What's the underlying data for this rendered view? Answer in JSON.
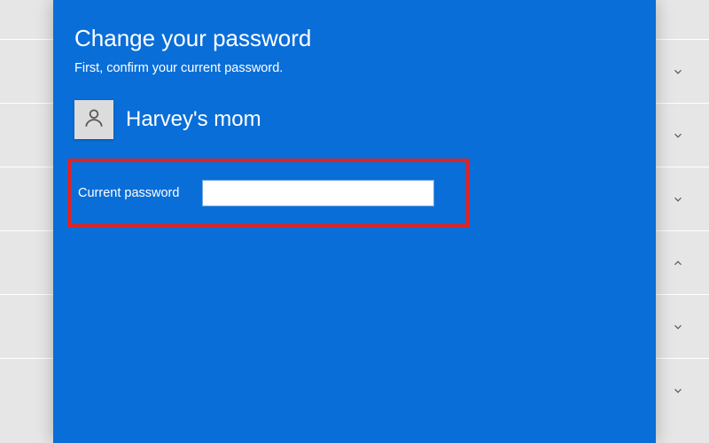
{
  "dialog": {
    "title": "Change your password",
    "subtitle": "First, confirm your current password."
  },
  "user": {
    "display_name": "Harvey's  mom"
  },
  "field": {
    "label": "Current password",
    "value": ""
  },
  "bg_rows": [
    {
      "dir": "down"
    },
    {
      "dir": "down"
    },
    {
      "dir": "down"
    },
    {
      "dir": "up"
    },
    {
      "dir": "down"
    },
    {
      "dir": "down"
    }
  ],
  "colors": {
    "accent": "#0a6ed8",
    "highlight": "#e32121"
  }
}
